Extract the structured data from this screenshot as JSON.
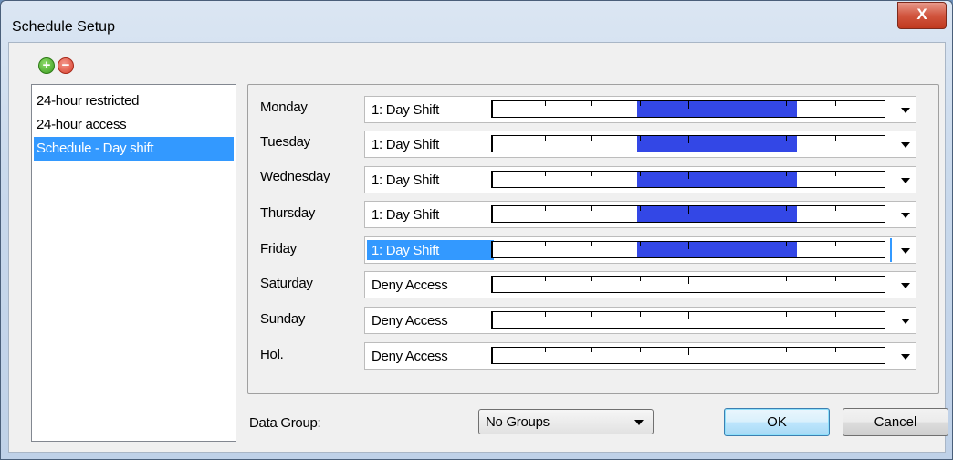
{
  "window": {
    "title": "Schedule Setup",
    "close_label": "X"
  },
  "toolbar": {
    "add_icon": "add-icon",
    "remove_icon": "remove-icon"
  },
  "schedules": {
    "items": [
      {
        "label": "24-hour restricted",
        "selected": false
      },
      {
        "label": "24-hour access",
        "selected": false
      },
      {
        "label": "Schedule - Day shift",
        "selected": true
      }
    ]
  },
  "days": [
    {
      "label": "Monday",
      "value": "1: Day Shift",
      "access_fraction": [
        0.37,
        0.78
      ],
      "focused": false
    },
    {
      "label": "Tuesday",
      "value": "1: Day Shift",
      "access_fraction": [
        0.37,
        0.78
      ],
      "focused": false
    },
    {
      "label": "Wednesday",
      "value": "1: Day Shift",
      "access_fraction": [
        0.37,
        0.78
      ],
      "focused": false
    },
    {
      "label": "Thursday",
      "value": "1: Day Shift",
      "access_fraction": [
        0.37,
        0.78
      ],
      "focused": false
    },
    {
      "label": "Friday",
      "value": "1: Day Shift",
      "access_fraction": [
        0.37,
        0.78
      ],
      "focused": true
    },
    {
      "label": "Saturday",
      "value": "Deny Access",
      "access_fraction": null,
      "focused": false
    },
    {
      "label": "Sunday",
      "value": "Deny Access",
      "access_fraction": null,
      "focused": false
    },
    {
      "label": "Hol.",
      "value": "Deny Access",
      "access_fraction": null,
      "focused": false
    }
  ],
  "data_group": {
    "label": "Data Group:",
    "value": "No Groups"
  },
  "buttons": {
    "ok": "OK",
    "cancel": "Cancel"
  },
  "colors": {
    "selection": "#3399ff",
    "schedule_fill": "#3347e6",
    "close_red": "#c0391f"
  }
}
